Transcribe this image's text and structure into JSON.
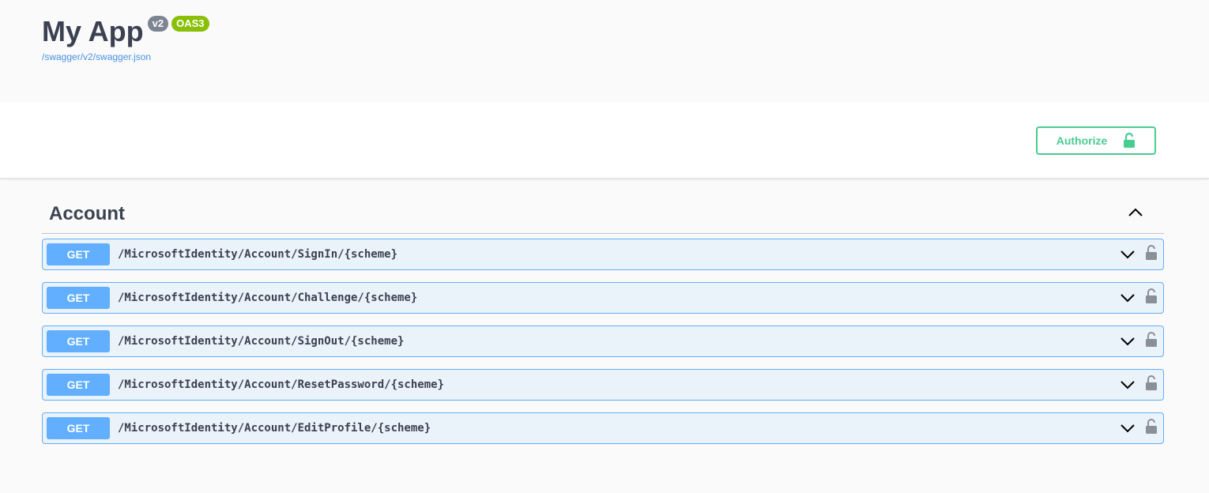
{
  "info": {
    "title": "My App",
    "version_badge": "v2",
    "oas_badge": "OAS3",
    "spec_url": "/swagger/v2/swagger.json"
  },
  "scheme_bar": {
    "authorize_label": "Authorize",
    "authorize_icon": "unlocked-icon"
  },
  "section": {
    "tag": "Account",
    "collapse_icon": "chevron-up-icon",
    "operations": [
      {
        "method": "GET",
        "path": "/MicrosoftIdentity/Account/SignIn/{scheme}"
      },
      {
        "method": "GET",
        "path": "/MicrosoftIdentity/Account/Challenge/{scheme}"
      },
      {
        "method": "GET",
        "path": "/MicrosoftIdentity/Account/SignOut/{scheme}"
      },
      {
        "method": "GET",
        "path": "/MicrosoftIdentity/Account/ResetPassword/{scheme}"
      },
      {
        "method": "GET",
        "path": "/MicrosoftIdentity/Account/EditProfile/{scheme}"
      }
    ]
  },
  "colors": {
    "get": "#61affe",
    "authorize": "#49cc90",
    "oas": "#89bf04",
    "version": "#7d8492"
  }
}
